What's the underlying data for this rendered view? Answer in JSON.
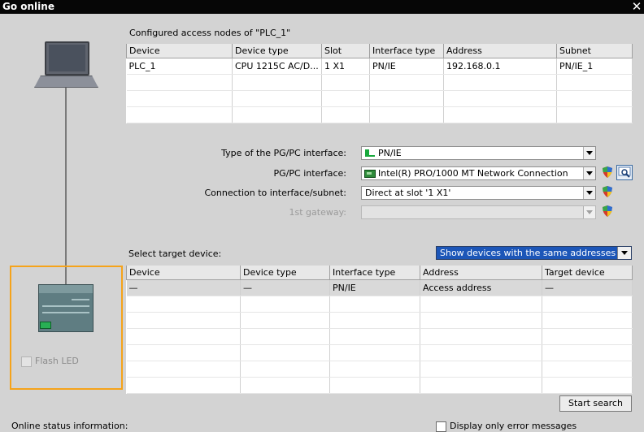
{
  "window": {
    "title": "Go online",
    "close_glyph": "✕"
  },
  "configured": {
    "label": "Configured access nodes of \"PLC_1\"",
    "columns": [
      "Device",
      "Device type",
      "Slot",
      "Interface type",
      "Address",
      "Subnet"
    ],
    "rows": [
      [
        "PLC_1",
        "CPU 1215C AC/D...",
        "1 X1",
        "PN/IE",
        "192.168.0.1",
        "PN/IE_1"
      ]
    ]
  },
  "form": {
    "interface_type_label": "Type of the PG/PC interface:",
    "interface_type_value": "PN/IE",
    "interface_label": "PG/PC interface:",
    "interface_value": "Intel(R) PRO/1000 MT Network Connection",
    "connection_label": "Connection to interface/subnet:",
    "connection_value": "Direct at slot '1 X1'",
    "gateway_label": "1st gateway:",
    "gateway_value": ""
  },
  "target": {
    "label": "Select target device:",
    "filter_value": "Show devices with the same addresses",
    "columns": [
      "Device",
      "Device type",
      "Interface type",
      "Address",
      "Target device"
    ],
    "rows": [
      [
        "—",
        "—",
        "PN/IE",
        "Access address",
        "—"
      ]
    ]
  },
  "device_panel": {
    "flash_label": "Flash LED"
  },
  "buttons": {
    "start_search": "Start search"
  },
  "footer": {
    "online_status_label": "Online status information:",
    "error_only_label": "Display only error messages"
  },
  "colors": {
    "highlight_border": "#f5a31a",
    "dropdown_selected": "#1c56b8"
  },
  "icons": [
    "close-icon",
    "laptop-icon",
    "plc-device-icon",
    "network-adapter-icon",
    "shield-icon",
    "diagnostics-icon",
    "dropdown-arrow-icon"
  ]
}
